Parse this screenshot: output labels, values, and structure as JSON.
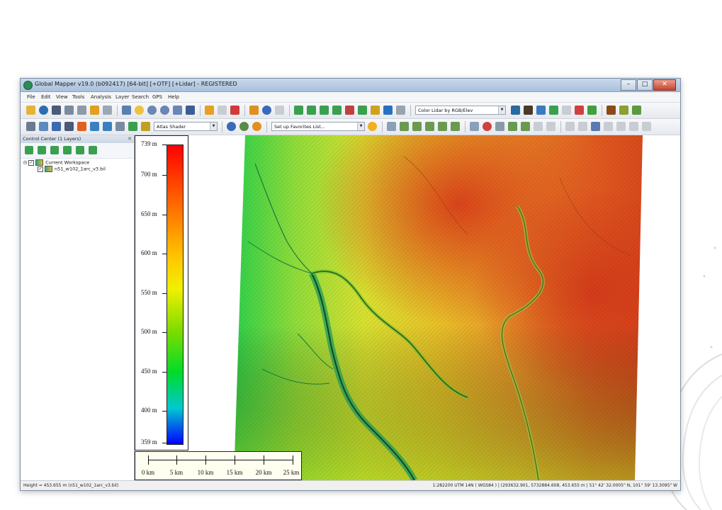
{
  "window": {
    "title": "Global Mapper v19.0 (b092417) [64-bit] [+OTF] [+Lidar] - REGISTERED",
    "buttons": {
      "minimize": "–",
      "maximize": "□",
      "close": "✕"
    }
  },
  "menu": [
    "File",
    "Edit",
    "View",
    "Tools",
    "Analysis",
    "Layer",
    "Search",
    "GPS",
    "Help"
  ],
  "toolbar": {
    "lidar_color_mode": "Color Lidar by RGB/Elev",
    "shader": "Atlas Shader",
    "favorites": "Set up Favorites List..."
  },
  "control_center": {
    "title": "Control Center (1 Layers)",
    "close_glyph": "✕",
    "workspace": "Current Workspace",
    "layer": "n51_w102_1arc_v3.bil"
  },
  "legend": {
    "labels": [
      "739 m",
      "700 m",
      "650 m",
      "600 m",
      "550 m",
      "500 m",
      "450 m",
      "400 m",
      "359 m"
    ],
    "min_m": 359,
    "max_m": 739,
    "colors_top_to_bottom": [
      "#ff0000",
      "#ff6a00",
      "#ffc800",
      "#f0f000",
      "#7fdc00",
      "#00dc28",
      "#00c8d2",
      "#0000ff"
    ]
  },
  "scale_bar": {
    "labels": [
      "0 km",
      "5 km",
      "10 km",
      "15 km",
      "20 km",
      "25 km"
    ]
  },
  "status": {
    "left": "Height = 453.655 m (n51_w102_1arc_v3.bil)",
    "right": "1:282200  UTM 14N ( WGS84 ) | (293632.901, 5732884.608, 453.655 m | 51° 42' 32.0005\" N, 101° 59' 13.3095\" W"
  }
}
